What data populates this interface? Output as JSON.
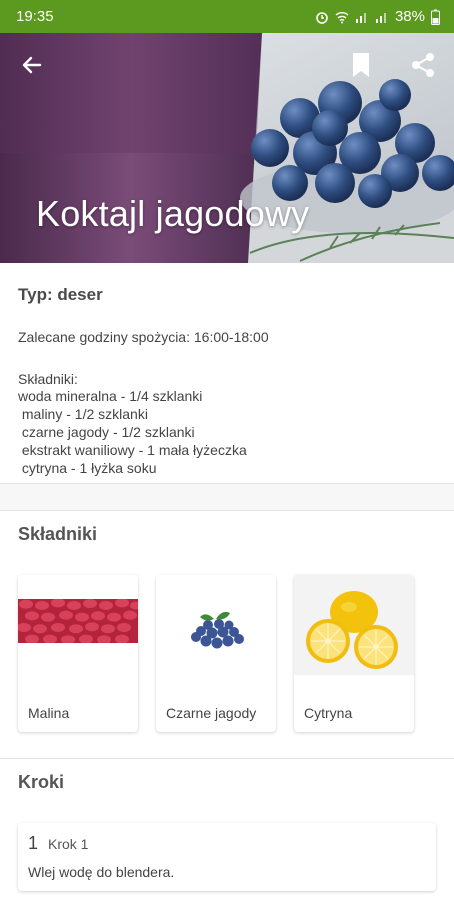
{
  "status_bar": {
    "time": "19:35",
    "battery": "38%",
    "icons": [
      "alarm-icon",
      "wifi-icon",
      "signal-icon",
      "signal-icon",
      "battery-icon"
    ]
  },
  "toolbar": {
    "back_icon": "arrow-left-icon",
    "bookmark_icon": "bookmark-icon",
    "share_icon": "share-icon"
  },
  "recipe": {
    "title": "Koktajl jagodowy",
    "type": "Typ: deser",
    "hours": "Zalecane godziny spożycia: 16:00-18:00",
    "ingredients_label": "Składniki:",
    "ingredients_lines": [
      "woda mineralna - 1/4 szklanki",
      " maliny - 1/2 szklanki",
      " czarne jagody - 1/2 szklanki",
      " ekstrakt waniliowy - 1 mała łyżeczka",
      " cytryna - 1 łyżka soku"
    ]
  },
  "ingredients_section": {
    "title": "Składniki",
    "cards": [
      {
        "label": "Malina",
        "image": "raspberries"
      },
      {
        "label": "Czarne jagody",
        "image": "blueberries"
      },
      {
        "label": "Cytryna",
        "image": "lemon"
      }
    ]
  },
  "steps_section": {
    "title": "Kroki",
    "steps": [
      {
        "number": "1",
        "title": "Krok 1",
        "text": "Wlej wodę do blendera."
      }
    ]
  },
  "colors": {
    "status_bar": "#5b9a1f",
    "smoothie": "#6b3f6a",
    "blueberry": "#2c4a7c"
  }
}
